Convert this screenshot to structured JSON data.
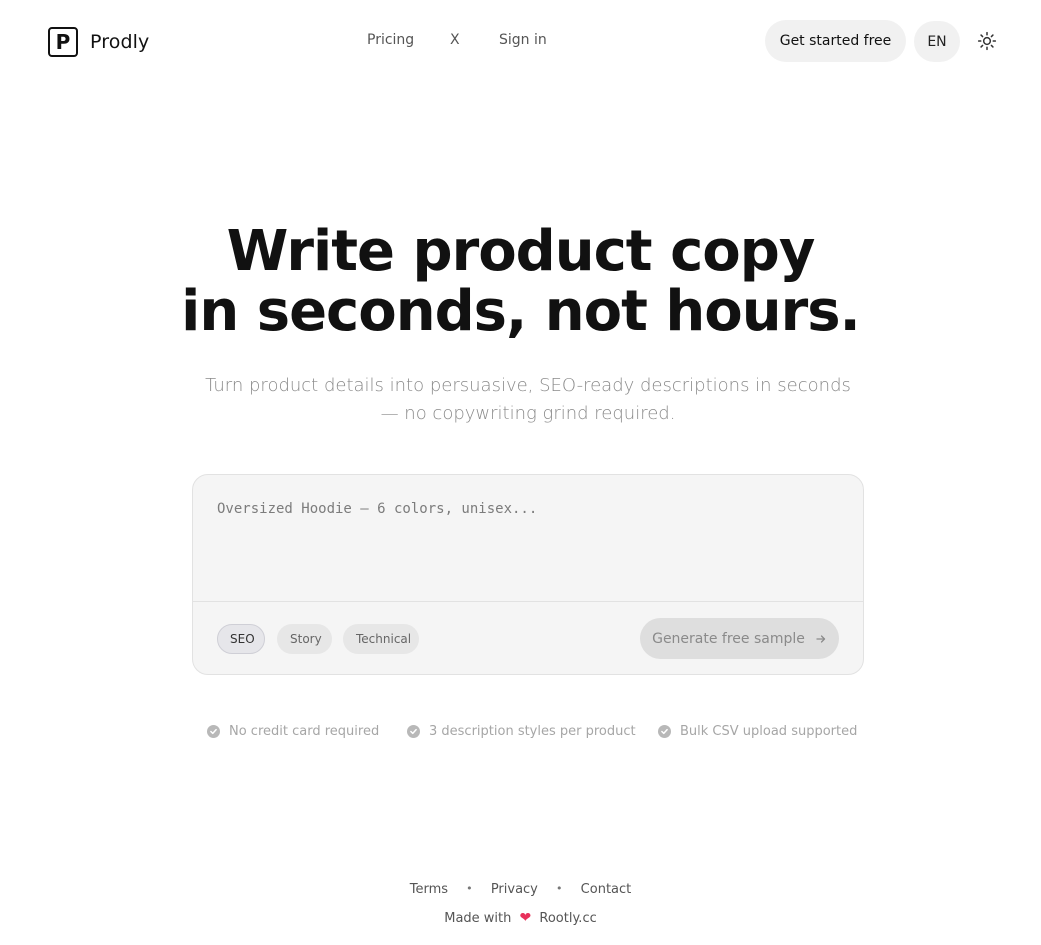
{
  "header": {
    "brand_name": "Prodly",
    "logo_letter": "P",
    "nav": [
      {
        "label": "Pricing"
      },
      {
        "label": "X"
      },
      {
        "label": "Sign in"
      }
    ],
    "cta_label": "Get started free",
    "language": "EN",
    "theme_icon": "sun-icon"
  },
  "hero": {
    "title_line1": "Write product copy",
    "title_line2": "in seconds, not hours.",
    "subtitle_line1": "Turn product details into persuasive, SEO-ready descriptions in seconds",
    "subtitle_line2": "— no copywriting grind required."
  },
  "input_card": {
    "placeholder": "Oversized Hoodie — 6 colors, unisex...",
    "value": "",
    "styles": [
      {
        "label": "SEO",
        "active": true
      },
      {
        "label": "Story",
        "active": false
      },
      {
        "label": "Technical",
        "active": false
      }
    ],
    "generate_label": "Generate free sample",
    "generate_icon": "arrow-right-icon"
  },
  "features": [
    {
      "label": "No credit card required",
      "icon": "check-circle-icon"
    },
    {
      "label": "3 description styles per product",
      "icon": "check-circle-icon"
    },
    {
      "label": "Bulk CSV upload supported",
      "icon": "check-circle-icon"
    }
  ],
  "footer": {
    "links": [
      {
        "label": "Terms"
      },
      {
        "label": "Privacy"
      },
      {
        "label": "Contact"
      }
    ],
    "made_with_prefix": "Made with",
    "made_with_icon": "heart-icon",
    "made_with_site": "Rootly.cc"
  },
  "colors": {
    "heart": "#e8315b",
    "muted_text": "#8a8a8a",
    "card_bg": "#f5f5f5"
  }
}
